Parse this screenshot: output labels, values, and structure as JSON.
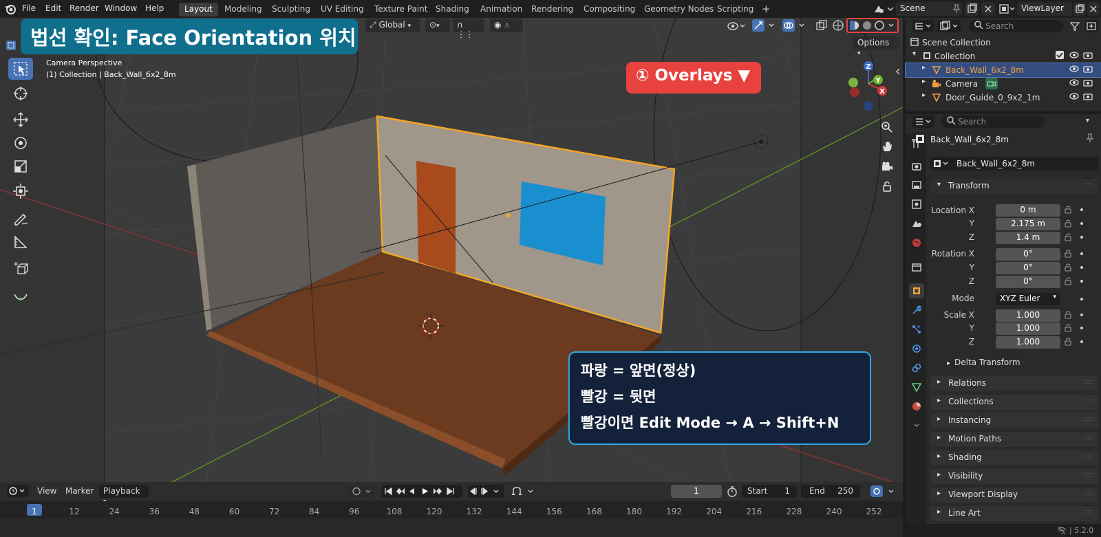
{
  "menu": {
    "file": "File",
    "edit": "Edit",
    "render": "Render",
    "window": "Window",
    "help": "Help"
  },
  "workspaces": [
    "Layout",
    "Modeling",
    "Sculpting",
    "UV Editing",
    "Texture Paint",
    "Shading",
    "Animation",
    "Rendering",
    "Compositing",
    "Geometry Nodes",
    "Scripting"
  ],
  "add_workspace": "+",
  "scene": {
    "name": "Scene"
  },
  "view_layer": {
    "name": "ViewLayer"
  },
  "viewport": {
    "camera_label": "Camera Perspective",
    "collection_label": "(1) Collection | Back_Wall_6x2_8m",
    "transform_orientation": "Global",
    "options_label": "Options",
    "axes": {
      "x": "X",
      "y": "Y",
      "z": "Z"
    }
  },
  "annotations": {
    "title": "법선 확인: Face Orientation 위치",
    "overlays_callout": "① Overlays ▼",
    "legend_line1": "파랑 = 앞면(정상)",
    "legend_line2": "빨강 = 뒷면",
    "legend_line3": "빨강이면 Edit Mode → A → Shift+N"
  },
  "timeline": {
    "view": "View",
    "marker": "Marker",
    "playback": "Playback",
    "current_frame": "1",
    "start_label": "Start",
    "start": "1",
    "end_label": "End",
    "end": "250",
    "ruler": [
      "1",
      "12",
      "24",
      "36",
      "48",
      "60",
      "72",
      "84",
      "96",
      "108",
      "120",
      "132",
      "144",
      "156",
      "168",
      "180",
      "192",
      "204",
      "216",
      "228",
      "240",
      "252"
    ]
  },
  "outliner": {
    "search_placeholder": "Search",
    "scene_collection": "Scene Collection",
    "collection": "Collection",
    "items": [
      "Back_Wall_6x2_8m",
      "Camera",
      "Door_Guide_0_9x2_1m"
    ]
  },
  "properties": {
    "search_placeholder": "Search",
    "object_name": "Back_Wall_6x2_8m",
    "object_field": "Back_Wall_6x2_8m",
    "transform_title": "Transform",
    "location": {
      "label": "Location X",
      "y_label": "Y",
      "z_label": "Z",
      "x": "0 m",
      "y": "2.175 m",
      "z": "1.4 m"
    },
    "rotation": {
      "label": "Rotation X",
      "y_label": "Y",
      "z_label": "Z",
      "x": "0°",
      "y": "0°",
      "z": "0°"
    },
    "mode_label": "Mode",
    "mode_value": "XYZ Euler",
    "scale": {
      "label": "Scale X",
      "y_label": "Y",
      "z_label": "Z",
      "x": "1.000",
      "y": "1.000",
      "z": "1.000"
    },
    "delta_transform": "Delta Transform",
    "panels": [
      "Relations",
      "Collections",
      "Instancing",
      "Motion Paths",
      "Shading",
      "Visibility",
      "Viewport Display",
      "Line Art"
    ]
  },
  "status_bar": {
    "version": "5.2.0"
  },
  "colors": {
    "accent": "#4772b3",
    "selection_outline": "#f5a623",
    "callout_red": "#e8423f",
    "callout_teal": "#0f6f8c",
    "legend_bg": "#14213a",
    "legend_border": "#2fa8e0",
    "floor": "#6b3a1f",
    "wall": "#a0968a",
    "door": "#a84a1c",
    "window": "#1a8fd0"
  }
}
